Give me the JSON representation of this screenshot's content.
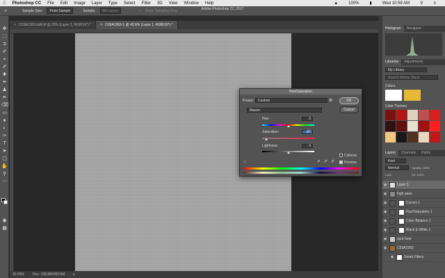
{
  "menubar": {
    "app": "Photoshop CC",
    "items": [
      "File",
      "Edit",
      "Image",
      "Layer",
      "Type",
      "Select",
      "Filter",
      "3D",
      "View",
      "Window",
      "Help"
    ],
    "title": "Adobe Photoshop CC 2017",
    "battery": "100%",
    "clock": "Wed 10:59 AM"
  },
  "options": {
    "sample_size_label": "Sample Size:",
    "sample_size_value": "Point Sample",
    "sample_label": "Sample:",
    "sample_value": "All Layers",
    "show_ring": "Show Sampling Ring"
  },
  "tabs": [
    {
      "label": "C03A1993-Edit.tif @ 25% (Layer 2, RGB/16*) *"
    },
    {
      "label": "C03A1993-1 @ 42.6% (Layer 1, RGB/16*) *"
    }
  ],
  "status": {
    "zoom": "42.59%",
    "doc": "Doc: 138.8M/383.5M"
  },
  "dialog": {
    "title": "Hue/Saturation",
    "preset_label": "Preset:",
    "preset_value": "Custom",
    "channel_value": "Master",
    "hue_label": "Hue:",
    "hue_value": "0",
    "saturation_label": "Saturation:",
    "saturation_value": "-87",
    "lightness_label": "Lightness:",
    "lightness_value": "0",
    "ok": "OK",
    "cancel": "Cancel",
    "colorize": "Colorize",
    "preview": "Preview"
  },
  "panels": {
    "tabs_top": [
      "Histogram",
      "Navigator"
    ],
    "tabs_lib": [
      "Libraries",
      "Adjustments"
    ],
    "library_value": "My Library",
    "search_placeholder": "Search Adobe Stock",
    "colors_heading": "Colors",
    "themes_heading": "Color Themes",
    "tabs_layers": [
      "Layers",
      "Channels",
      "Paths"
    ],
    "kind": "Kind",
    "blend": "Normal",
    "opacity": "Opacity: 100%",
    "lock": "Lock:",
    "fill": "Fill: 100%",
    "layers": [
      {
        "name": "Layer 1",
        "selected": true
      },
      {
        "name": "high pass"
      },
      {
        "name": "Curves 1"
      },
      {
        "name": "Hue/Saturation 1"
      },
      {
        "name": "Color Balance 1"
      },
      {
        "name": "Black & White 1"
      },
      {
        "name": "spot heal"
      },
      {
        "name": "C03A1993"
      },
      {
        "name": "Smart Filters"
      }
    ]
  },
  "colors": {
    "accent_swatch": "#e7b838",
    "theme_colors": [
      "#7a1010",
      "#b01818",
      "#e0d0c0",
      "#c05050",
      "#d82020",
      "#301010",
      "#601010",
      "#e8e0d0",
      "#a01010",
      "#ff2020",
      "#f0c880",
      "#181818",
      "#503020",
      "#e8d8c0",
      "#c01818"
    ]
  }
}
